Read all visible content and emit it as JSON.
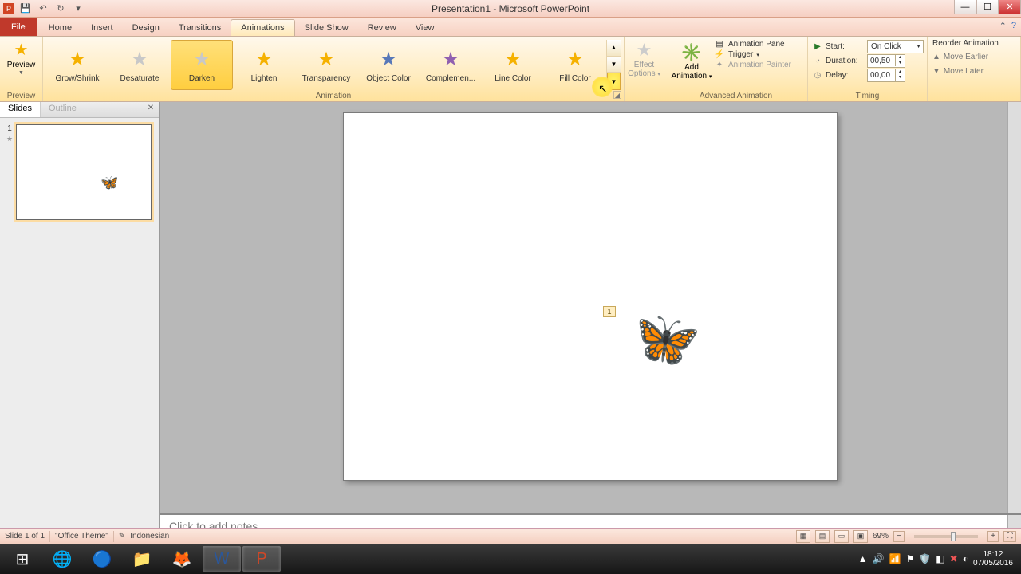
{
  "titlebar": {
    "title": "Presentation1 - Microsoft PowerPoint"
  },
  "tabs": {
    "file": "File",
    "items": [
      "Home",
      "Insert",
      "Design",
      "Transitions",
      "Animations",
      "Slide Show",
      "Review",
      "View"
    ],
    "activeIndex": 4
  },
  "ribbon": {
    "preview": {
      "label": "Preview",
      "group": "Preview"
    },
    "animationGroup": "Animation",
    "gallery": [
      {
        "name": "Grow/Shrink",
        "color": "yellow"
      },
      {
        "name": "Desaturate",
        "color": "grey"
      },
      {
        "name": "Darken",
        "color": "grey",
        "selected": true
      },
      {
        "name": "Lighten",
        "color": "yellow"
      },
      {
        "name": "Transparency",
        "color": "yellow"
      },
      {
        "name": "Object Color",
        "color": "blue"
      },
      {
        "name": "Complemen...",
        "color": "purple"
      },
      {
        "name": "Line Color",
        "color": "yellow"
      },
      {
        "name": "Fill Color",
        "color": "yellow"
      }
    ],
    "effectOptions": "Effect Options",
    "advanced": {
      "group": "Advanced Animation",
      "addAnimation": "Add Animation",
      "pane": "Animation Pane",
      "trigger": "Trigger",
      "painter": "Animation Painter"
    },
    "timing": {
      "group": "Timing",
      "start": {
        "label": "Start:",
        "value": "On Click"
      },
      "duration": {
        "label": "Duration:",
        "value": "00,50"
      },
      "delay": {
        "label": "Delay:",
        "value": "00,00"
      }
    },
    "reorder": {
      "header": "Reorder Animation",
      "earlier": "Move Earlier",
      "later": "Move Later"
    }
  },
  "panel": {
    "slides": "Slides",
    "outline": "Outline",
    "slideNumber": "1"
  },
  "slide": {
    "animTag": "1"
  },
  "notes": {
    "placeholder": "Click to add notes"
  },
  "status": {
    "slide": "Slide 1 of 1",
    "theme": "\"Office Theme\"",
    "language": "Indonesian",
    "zoom": "69%"
  },
  "tray": {
    "time": "18:12",
    "date": "07/05/2016"
  }
}
